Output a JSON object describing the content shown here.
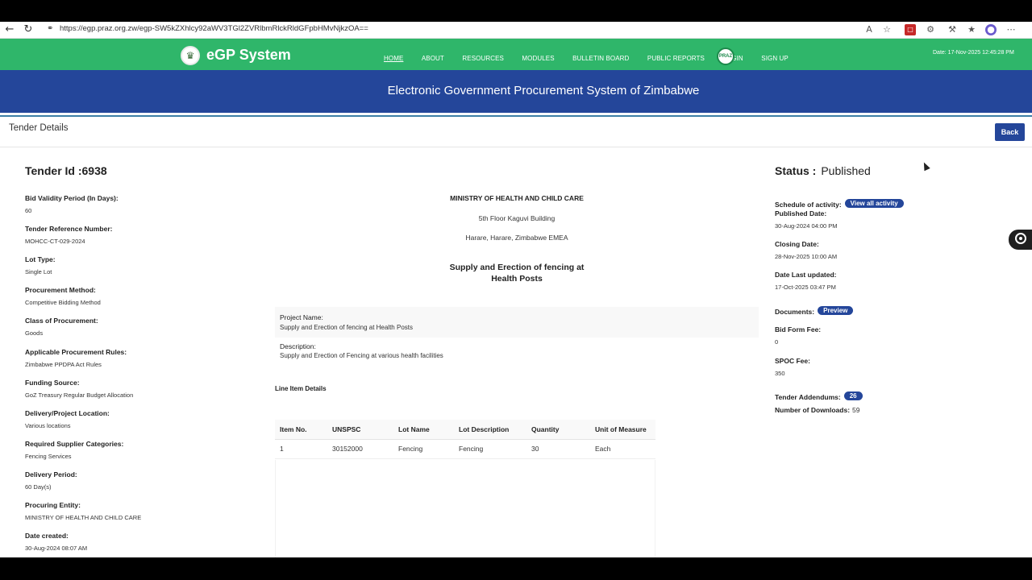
{
  "browser": {
    "url": "https://egp.praz.org.zw/egp-SW5kZXhlcy92aWV3TGl2ZVRlbmRlckRldGFpbHMvNjkzOA==",
    "icons": [
      "back-arrow-icon",
      "refresh-icon",
      "lock-icon",
      "read-aloud-icon",
      "favorite-star-icon",
      "pdf-extension-icon",
      "extensions-icon",
      "settings-icon",
      "favorites-icon",
      "profile-icon",
      "more-icon"
    ]
  },
  "header": {
    "brand": "eGP System",
    "menu": [
      "HOME",
      "ABOUT",
      "RESOURCES",
      "MODULES",
      "BULLETIN BOARD",
      "PUBLIC REPORTS",
      "LOGIN",
      "SIGN UP"
    ],
    "praz": "PRAZ",
    "date": "Date: 17-Nov-2025 12:45:28 PM",
    "banner": "Electronic Government Procurement System of Zimbabwe"
  },
  "page": {
    "title": "Tender Details",
    "back": "Back"
  },
  "left": {
    "tender_id": "Tender Id :6938",
    "fields": [
      {
        "label": "Bid Validity Period (In Days):",
        "value": "60"
      },
      {
        "label": "Tender Reference Number:",
        "value": "MOHCC-CT-029-2024"
      },
      {
        "label": "Lot Type:",
        "value": "Single Lot"
      },
      {
        "label": "Procurement Method:",
        "value": "Competitive Bidding Method"
      },
      {
        "label": "Class of Procurement:",
        "value": "Goods"
      },
      {
        "label": "Applicable Procurement Rules:",
        "value": "Zimbabwe PPDPA Act Rules"
      },
      {
        "label": "Funding Source:",
        "value": "GoZ Treasury Regular Budget Allocation"
      },
      {
        "label": "Delivery/Project Location:",
        "value": "Various locations"
      },
      {
        "label": "Required Supplier Categories:",
        "value": "Fencing Services"
      },
      {
        "label": "Delivery Period:",
        "value": "60 Day(s)"
      },
      {
        "label": "Procuring Entity:",
        "value": "MINISTRY OF HEALTH AND CHILD CARE"
      },
      {
        "label": "Date created:",
        "value": "30-Aug-2024 08:07 AM"
      }
    ]
  },
  "center": {
    "entity": "MINISTRY OF HEALTH AND CHILD CARE",
    "address1": "5th Floor Kaguvi Building",
    "address2": "Harare, Harare, Zimbabwe EMEA",
    "tender_title": "Supply and Erection of fencing at Health Posts",
    "project_name_label": "Project Name:",
    "project_name": "Supply and Erection of fencing at Health Posts",
    "description_label": "Description:",
    "description": "Supply and Erection of Fencing at various health facilities",
    "line_items_title": "Line Item Details",
    "table": {
      "headers": [
        "Item No.",
        "UNSPSC",
        "Lot Name",
        "Lot Description",
        "Quantity",
        "Unit of Measure"
      ],
      "rows": [
        [
          "1",
          "30152000",
          "Fencing",
          "Fencing",
          "30",
          "Each"
        ]
      ]
    }
  },
  "right": {
    "status_label": "Status :",
    "status_value": "Published",
    "schedule_label": "Schedule of activity:",
    "schedule_button": "View all activity",
    "published_label": "Published Date:",
    "published_value": "30-Aug-2024 04:00 PM",
    "closing_label": "Closing Date:",
    "closing_value": "28-Nov-2025 10:00 AM",
    "updated_label": "Date Last updated:",
    "updated_value": "17-Oct-2025 03:47 PM",
    "documents_label": "Documents:",
    "documents_button": "Preview",
    "bid_fee_label": "Bid Form Fee:",
    "bid_fee_value": "0",
    "spoc_label": "SPOC Fee:",
    "spoc_value": "350",
    "addendums_label": "Tender Addendums:",
    "addendums_count": "26",
    "downloads_label": "Number of Downloads:",
    "downloads_value": "59"
  },
  "colors": {
    "header_green": "#2fb66a",
    "banner_blue": "#24469a"
  }
}
